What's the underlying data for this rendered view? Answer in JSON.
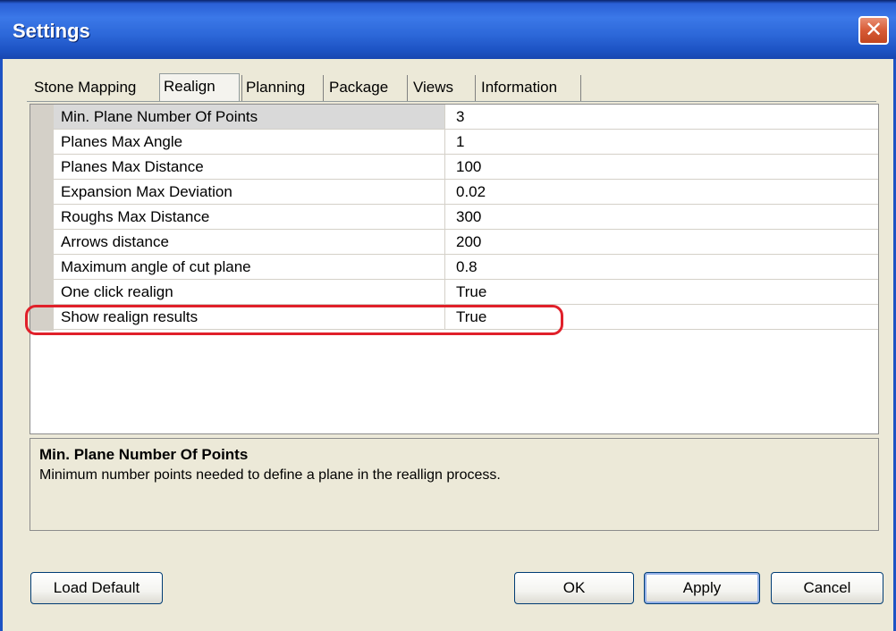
{
  "window": {
    "title": "Settings"
  },
  "tabs": [
    {
      "label": "Stone Mapping"
    },
    {
      "label": "Realign"
    },
    {
      "label": "Planning"
    },
    {
      "label": "Package"
    },
    {
      "label": "Views"
    },
    {
      "label": "Information"
    }
  ],
  "grid": {
    "rows": [
      {
        "name": "Min. Plane Number Of Points",
        "value": "3"
      },
      {
        "name": "Planes Max Angle",
        "value": "1"
      },
      {
        "name": "Planes Max Distance",
        "value": "100"
      },
      {
        "name": "Expansion Max Deviation",
        "value": "0.02"
      },
      {
        "name": "Roughs Max Distance",
        "value": "300"
      },
      {
        "name": "Arrows distance",
        "value": "200"
      },
      {
        "name": "Maximum angle of cut plane",
        "value": "0.8"
      },
      {
        "name": "One click realign",
        "value": "True"
      },
      {
        "name": "Show realign results",
        "value": "True"
      }
    ]
  },
  "description": {
    "title": "Min. Plane Number Of Points",
    "text": "Minimum number points needed to define a plane in the reallign process."
  },
  "buttons": {
    "load_default": "Load Default",
    "ok": "OK",
    "apply": "Apply",
    "cancel": "Cancel"
  },
  "annotation_color": "#e0202a"
}
